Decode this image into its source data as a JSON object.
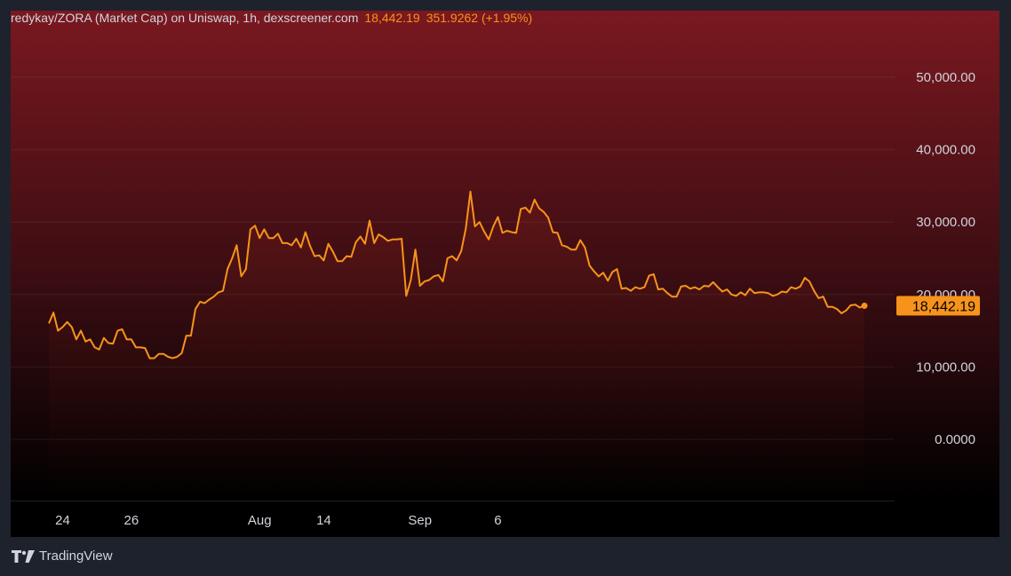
{
  "header": {
    "title": "redykay/ZORA (Market Cap) on Uniswap, 1h, dexscreener.com",
    "last_value": "18,442.19",
    "change": "351.9262 (+1.95%)"
  },
  "branding": {
    "label": "TradingView",
    "icon": "tradingview-logo-icon"
  },
  "colors": {
    "line": "#f7931a",
    "background_top": "#7a1820",
    "background_bottom": "#000000",
    "axis_text": "#d1d4dc",
    "price_tag_bg": "#f7931a",
    "price_tag_text": "#000000"
  },
  "chart_data": {
    "type": "line",
    "title": "redykay/ZORA (Market Cap) on Uniswap, 1h, dexscreener.com",
    "xlabel": "",
    "ylabel": "",
    "ylim": [
      -8000,
      57000
    ],
    "y_ticks": [
      "50,000.00",
      "40,000.00",
      "30,000.00",
      "20,000.00",
      "10,000.00",
      "0.0000"
    ],
    "y_tick_values": [
      50000,
      40000,
      30000,
      20000,
      10000,
      0
    ],
    "x_ticks": [
      "24",
      "26",
      "Aug",
      "14",
      "Sep",
      "6"
    ],
    "x_tick_index": [
      3,
      18,
      46,
      60,
      81,
      98
    ],
    "last_value": 18442.19,
    "last_value_label": "18,442.19",
    "grid": true,
    "series": [
      {
        "values": [
          16000,
          17500,
          15000,
          15500,
          16200,
          15500,
          13800,
          15000,
          13500,
          13800,
          12700,
          12400,
          14000,
          13300,
          13200,
          15000,
          15200,
          13800,
          13800,
          12700,
          12700,
          12600,
          11200,
          11200,
          11800,
          11800,
          11400,
          11200,
          11400,
          11900,
          14300,
          14300,
          18000,
          19000,
          18800,
          19300,
          19700,
          20300,
          20500,
          23500,
          25000,
          26800,
          22500,
          23500,
          29000,
          29500,
          27800,
          29000,
          27800,
          27800,
          28400,
          27100,
          27100,
          26800,
          27700,
          26500,
          28600,
          26700,
          25300,
          25400,
          24700,
          27000,
          25900,
          24600,
          24600,
          25300,
          25200,
          27200,
          28000,
          27000,
          30200,
          27100,
          28300,
          27900,
          27400,
          27600,
          27600,
          27700,
          19800,
          22000,
          26200,
          21200,
          21800,
          22000,
          22500,
          22700,
          21800,
          25000,
          25300,
          24700,
          26000,
          29100,
          34200,
          29400,
          30000,
          28700,
          27600,
          29400,
          30700,
          28500,
          28800,
          28600,
          28500,
          31800,
          32000,
          31300,
          33100,
          31900,
          31400,
          30600,
          28600,
          28500,
          26800,
          26600,
          26200,
          26200,
          27500,
          26500,
          24000,
          23200,
          22500,
          23000,
          21900,
          23100,
          23500,
          20800,
          20900,
          20500,
          21000,
          20800,
          21000,
          22600,
          22800,
          20700,
          20800,
          20200,
          19700,
          19700,
          21100,
          21200,
          20800,
          21000,
          20700,
          21200,
          21100,
          21700,
          21000,
          20400,
          20700,
          20000,
          19800,
          20300,
          19900,
          20800,
          20200,
          20300,
          20300,
          20200,
          19800,
          20000,
          20400,
          20300,
          21000,
          20800,
          21100,
          22300,
          21800,
          20500,
          19500,
          19700,
          18300,
          18300,
          18000,
          17400,
          17800,
          18500,
          18600,
          18200,
          18442.19
        ]
      }
    ]
  }
}
